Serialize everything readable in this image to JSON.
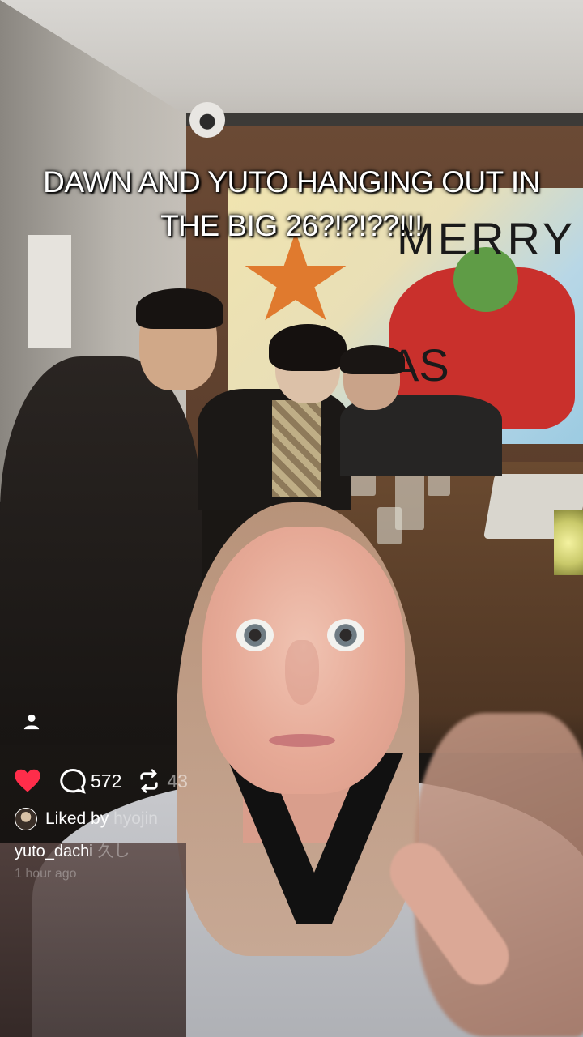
{
  "overlay": {
    "caption_line_1": "DAWN AND YUTO HANGING OUT IN",
    "caption_line_2": "THE BIG 26?!?!??!!!"
  },
  "background": {
    "poster_text_1": "MERRY",
    "poster_text_2": "AS"
  },
  "post": {
    "like_icon": "heart-icon",
    "like_color": "#ff2d4a",
    "comment_icon": "comment-icon",
    "comment_count": "572",
    "repost_icon": "repost-icon",
    "repost_count": "43",
    "liked_by_label": "Liked by",
    "liked_by_user": "hyojin",
    "caption_user": "yuto_dachi",
    "caption_rest": "久し",
    "timestamp": "1 hour ago"
  }
}
